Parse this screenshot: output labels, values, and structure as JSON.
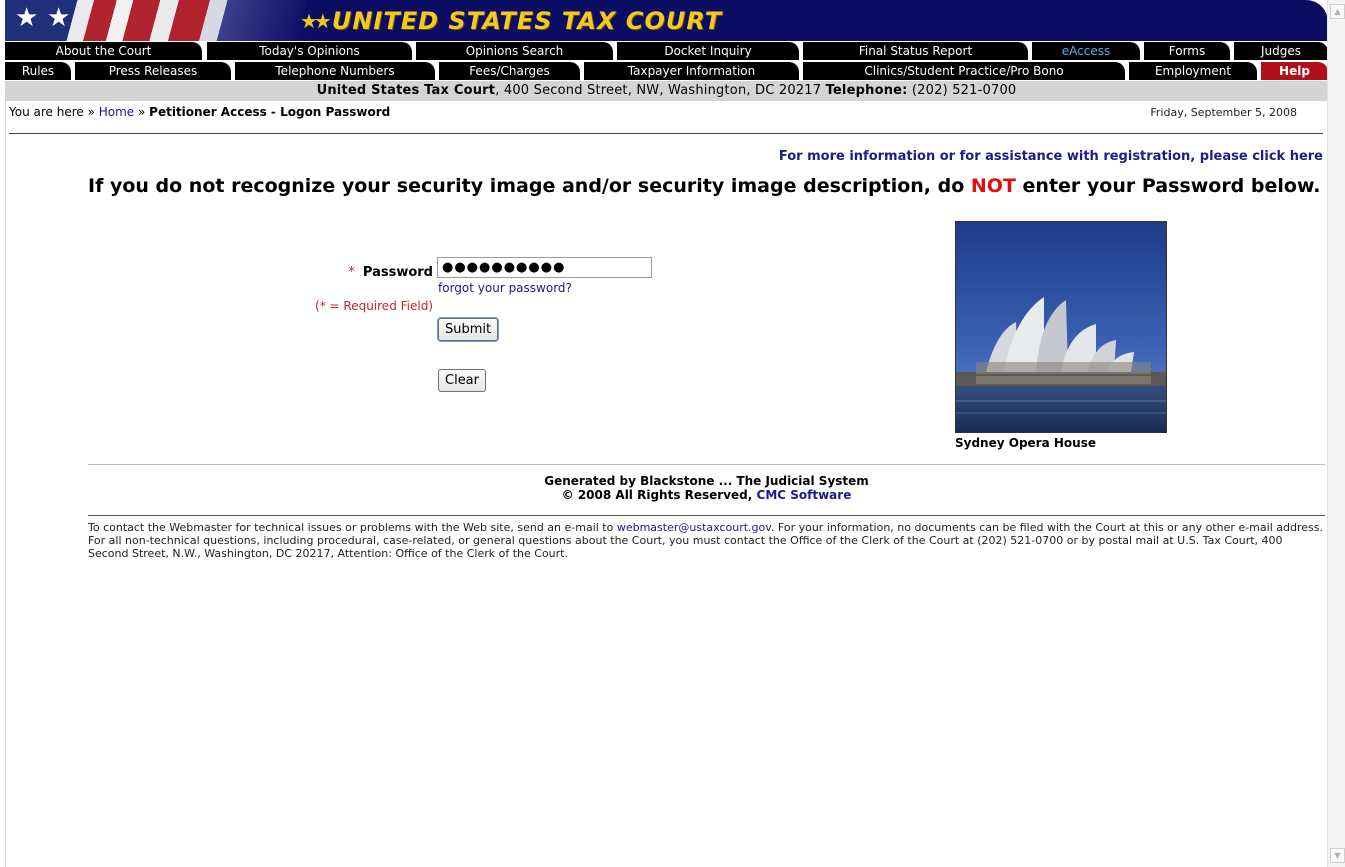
{
  "banner": {
    "logo_text": "UNITED STATES TAX COURT",
    "flag_star": "★",
    "logo_stars": "★★"
  },
  "nav_row1": [
    {
      "label": "About the Court",
      "key": "about"
    },
    {
      "label": "Today's Opinions",
      "key": "todays-opinions"
    },
    {
      "label": "Opinions Search",
      "key": "opinions-search"
    },
    {
      "label": "Docket Inquiry",
      "key": "docket-inquiry"
    },
    {
      "label": "Final Status Report",
      "key": "final-status-report"
    },
    {
      "label": "eAccess",
      "key": "eaccess",
      "active": true
    },
    {
      "label": "Forms",
      "key": "forms"
    },
    {
      "label": "Judges",
      "key": "judges"
    }
  ],
  "nav_row2": [
    {
      "label": "Rules",
      "key": "rules"
    },
    {
      "label": "Press Releases",
      "key": "press-releases"
    },
    {
      "label": "Telephone Numbers",
      "key": "telephone-numbers"
    },
    {
      "label": "Fees/Charges",
      "key": "fees-charges"
    },
    {
      "label": "Taxpayer Information",
      "key": "taxpayer-information"
    },
    {
      "label": "Clinics/Student Practice/Pro Bono",
      "key": "clinics"
    },
    {
      "label": "Employment",
      "key": "employment"
    },
    {
      "label": "Help",
      "key": "help"
    }
  ],
  "infobar": {
    "court_name": "United States Tax Court",
    "address": ", 400 Second Street, NW, Washington, DC 20217 ",
    "phone_label": "Telephone:",
    "phone": " (202) 521-0700"
  },
  "breadcrumb": {
    "prefix": "You are here » ",
    "home": "Home",
    "sep": " » ",
    "current": "Petitioner Access - Logon Password"
  },
  "date": "Friday, September 5, 2008",
  "more_info_link": "For more information or for assistance with registration, please click here",
  "warning": {
    "before": "If you do not recognize your security image and/or security image description, do ",
    "emph": "NOT",
    "after": " enter your Password below."
  },
  "form": {
    "required_mark": "*",
    "password_label": "Password",
    "password_value": "●●●●●●●●●●",
    "forgot_link": "forgot your password?",
    "required_note": "(* = Required Field)",
    "submit_label": "Submit",
    "clear_label": "Clear"
  },
  "security_image": {
    "caption": "Sydney Opera House"
  },
  "footer": {
    "generated": "Generated by Blackstone ... The Judicial System",
    "copyright": "© 2008 All Rights Reserved, ",
    "company": "CMC Software"
  },
  "contact": {
    "text1": "To contact the Webmaster for technical issues or problems with the Web site, send an e-mail to ",
    "email": "webmaster@ustaxcourt.gov",
    "text2": ". For your information, no documents can be filed with the Court at this or any other e-mail address. For all non-technical questions, including procedural, case-related, or general questions about the Court, you must contact the Office of the Clerk of the Court at (202) 521-0700 or by postal mail at U.S. Tax Court, 400 Second Street, N.W., Washington, DC 20217, Attention: Office of the Clerk of the Court."
  },
  "scrollbar": {
    "up_glyph": "▲",
    "down_glyph": "▼"
  },
  "colors": {
    "banner_navy": "#0b0d63",
    "logo_gold": "#f4c924",
    "tab_black": "#000000",
    "help_red": "#b0101a",
    "link_blue": "#1a1a8c",
    "alert_red": "#e01010"
  }
}
